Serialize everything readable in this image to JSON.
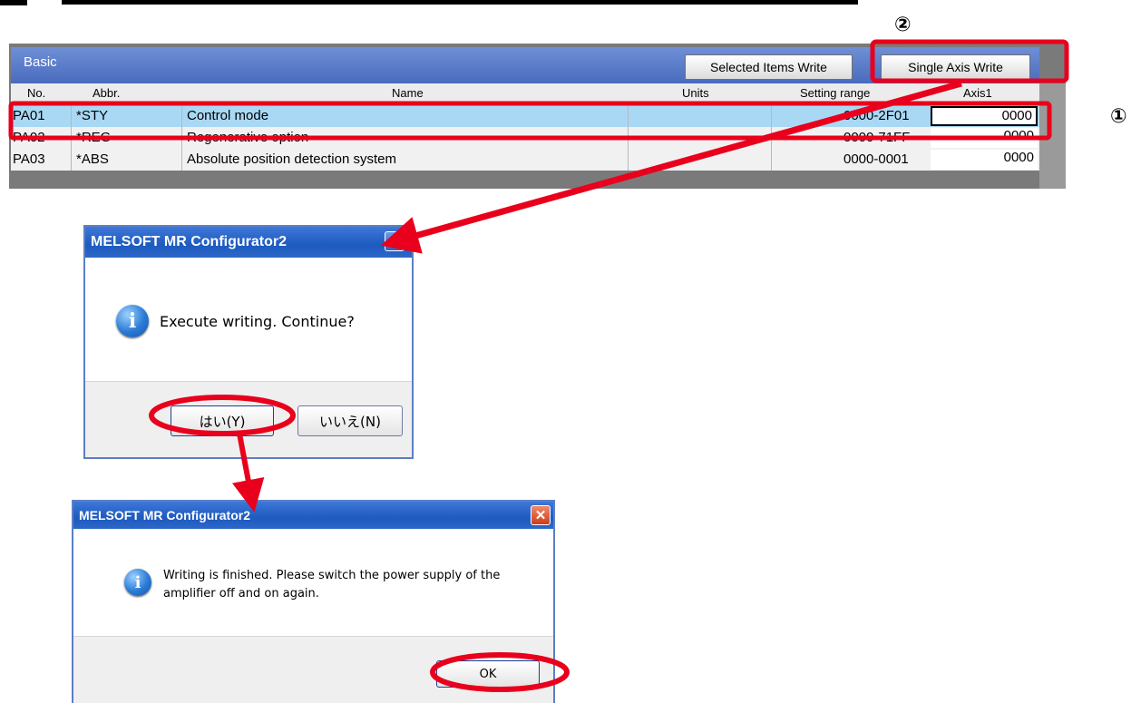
{
  "grid": {
    "section_title": "Basic",
    "buttons": {
      "selected_items_write": "Selected Items Write",
      "single_axis_write": "Single Axis Write"
    },
    "columns": [
      "No.",
      "Abbr.",
      "Name",
      "Units",
      "Setting range",
      "Axis1"
    ],
    "rows": [
      {
        "no": "PA01",
        "abbr": "*STY",
        "name": "Control mode",
        "units": "",
        "range": "0000-2F01",
        "axis1": "0000",
        "selected": true
      },
      {
        "no": "PA02",
        "abbr": "*REG",
        "name": "Regenerative option",
        "units": "",
        "range": "0000-71FF",
        "axis1": "0000",
        "selected": false
      },
      {
        "no": "PA03",
        "abbr": "*ABS",
        "name": "Absolute position detection system",
        "units": "",
        "range": "0000-0001",
        "axis1": "0000",
        "selected": false
      }
    ]
  },
  "dialog_confirm": {
    "title": "MELSOFT MR Configurator2",
    "message": "Execute writing. Continue?",
    "yes_label": "はい(Y)",
    "no_label": "いいえ(N)",
    "close_glyph": "✕",
    "icon": "info-icon"
  },
  "dialog_finished": {
    "title": "MELSOFT MR Configurator2",
    "message_line1": "Writing is finished. Please switch the power supply of the",
    "message_line2": "amplifier off and on again.",
    "ok_label": "OK",
    "close_glyph": "✕",
    "icon": "info-icon"
  },
  "annotations": {
    "step1": "①",
    "step2": "②",
    "highlight_color": "#e8001c"
  }
}
